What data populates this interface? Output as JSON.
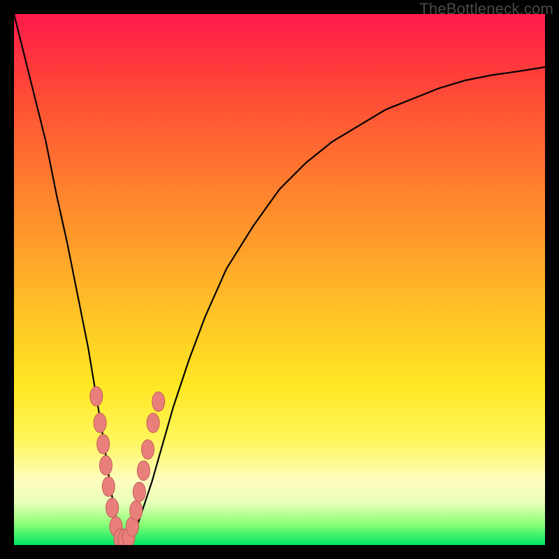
{
  "watermark": "TheBottleneck.com",
  "colors": {
    "curve": "#000000",
    "marker_fill": "#e97f7b",
    "marker_stroke": "#c15b57",
    "frame": "#000000"
  },
  "chart_data": {
    "type": "line",
    "title": "",
    "xlabel": "",
    "ylabel": "",
    "xlim": [
      0,
      100
    ],
    "ylim": [
      0,
      100
    ],
    "x": [
      0,
      2,
      4,
      6,
      8,
      10,
      12,
      14,
      15,
      16,
      17,
      18,
      19,
      20,
      21,
      22,
      23,
      24,
      26,
      28,
      30,
      33,
      36,
      40,
      45,
      50,
      55,
      60,
      65,
      70,
      75,
      80,
      85,
      90,
      95,
      100
    ],
    "y": [
      100,
      92,
      84,
      76,
      66,
      57,
      47,
      37,
      31,
      25,
      19,
      12,
      6,
      2,
      0,
      1,
      3,
      6,
      12,
      19,
      26,
      35,
      43,
      52,
      60,
      67,
      72,
      76,
      79,
      82,
      84,
      86,
      87.5,
      88.5,
      89.2,
      90
    ],
    "series": [
      {
        "name": "curve",
        "note": "V-shaped bottleneck curve; minimum near x≈20"
      }
    ],
    "markers": {
      "note": "salmon oval markers clustered near the valley on both slopes",
      "points": [
        {
          "x": 15.5,
          "y": 28
        },
        {
          "x": 16.2,
          "y": 23
        },
        {
          "x": 16.8,
          "y": 19
        },
        {
          "x": 17.3,
          "y": 15
        },
        {
          "x": 17.8,
          "y": 11
        },
        {
          "x": 18.5,
          "y": 7
        },
        {
          "x": 19.2,
          "y": 3.5
        },
        {
          "x": 20.0,
          "y": 1.2
        },
        {
          "x": 20.8,
          "y": 1.2
        },
        {
          "x": 21.6,
          "y": 1.5
        },
        {
          "x": 22.3,
          "y": 3.5
        },
        {
          "x": 23.0,
          "y": 6.5
        },
        {
          "x": 23.6,
          "y": 10
        },
        {
          "x": 24.4,
          "y": 14
        },
        {
          "x": 25.2,
          "y": 18
        },
        {
          "x": 26.2,
          "y": 23
        },
        {
          "x": 27.2,
          "y": 27
        }
      ]
    }
  }
}
